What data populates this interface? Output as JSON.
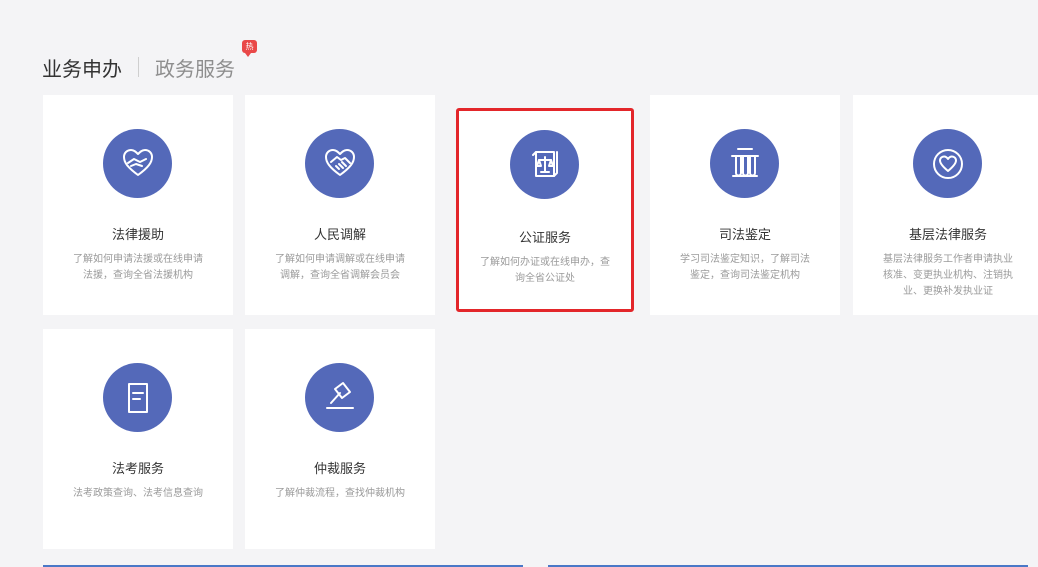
{
  "tabs": {
    "active": "业务申办",
    "inactive": "政务服务",
    "badge": "热"
  },
  "colors": {
    "icon_bg": "#5469b9",
    "selected_border": "#e3262a",
    "badge": "#e94848"
  },
  "cards": [
    {
      "title": "法律援助",
      "desc": "了解如何申请法援或在线申请法援，查询全省法援机构",
      "icon": "heart-hands-icon"
    },
    {
      "title": "人民调解",
      "desc": "了解如何申请调解或在线申请调解，查询全省调解会员会",
      "icon": "handshake-icon"
    },
    {
      "title": "公证服务",
      "desc": "了解如何办证或在线申办，查询全省公证处",
      "icon": "scales-scroll-icon"
    },
    {
      "title": "司法鉴定",
      "desc": "学习司法鉴定知识，了解司法鉴定，查询司法鉴定机构",
      "icon": "test-tubes-icon"
    },
    {
      "title": "基层法律服务",
      "desc": "基层法律服务工作者申请执业核准、变更执业机构、注销执业、更换补发执业证",
      "icon": "heart-circle-icon"
    },
    {
      "title": "法考服务",
      "desc": "法考政策查询、法考信息查询",
      "icon": "document-icon"
    },
    {
      "title": "仲裁服务",
      "desc": "了解仲裁流程，查找仲裁机构",
      "icon": "gavel-icon"
    }
  ]
}
